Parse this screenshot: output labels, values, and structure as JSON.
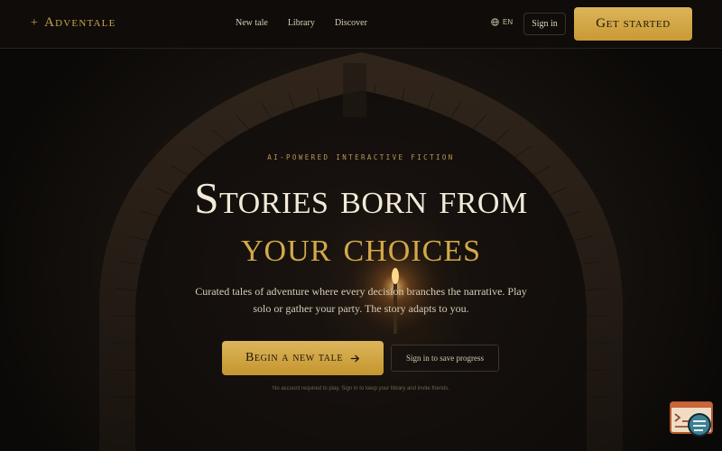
{
  "brand": {
    "name": "Adventale",
    "mark": "+"
  },
  "nav": {
    "items": [
      "New tale",
      "Library",
      "Discover"
    ]
  },
  "header": {
    "language": "EN",
    "signin_label": "Sign in",
    "get_started_label": "Get started"
  },
  "hero": {
    "eyebrow": "AI-POWERED INTERACTIVE FICTION",
    "title_line1": "Stories born from",
    "title_line2": "your choices",
    "subtitle": "Curated tales of adventure where every decision branches the narrative. Play solo or gather your party. The story adapts to you.",
    "cta_label": "Begin a new tale",
    "secondary_label": "Sign in to save progress",
    "footnote": "No account required to play. Sign in to keep your library and invite friends."
  },
  "colors": {
    "accent_gold": "#d3a94a",
    "background": "#0d0a08",
    "text_light": "#f2ead8"
  },
  "icons": {
    "globe": "globe-icon",
    "arrow": "arrow-right-icon",
    "widget": "chat-widget-icon"
  }
}
